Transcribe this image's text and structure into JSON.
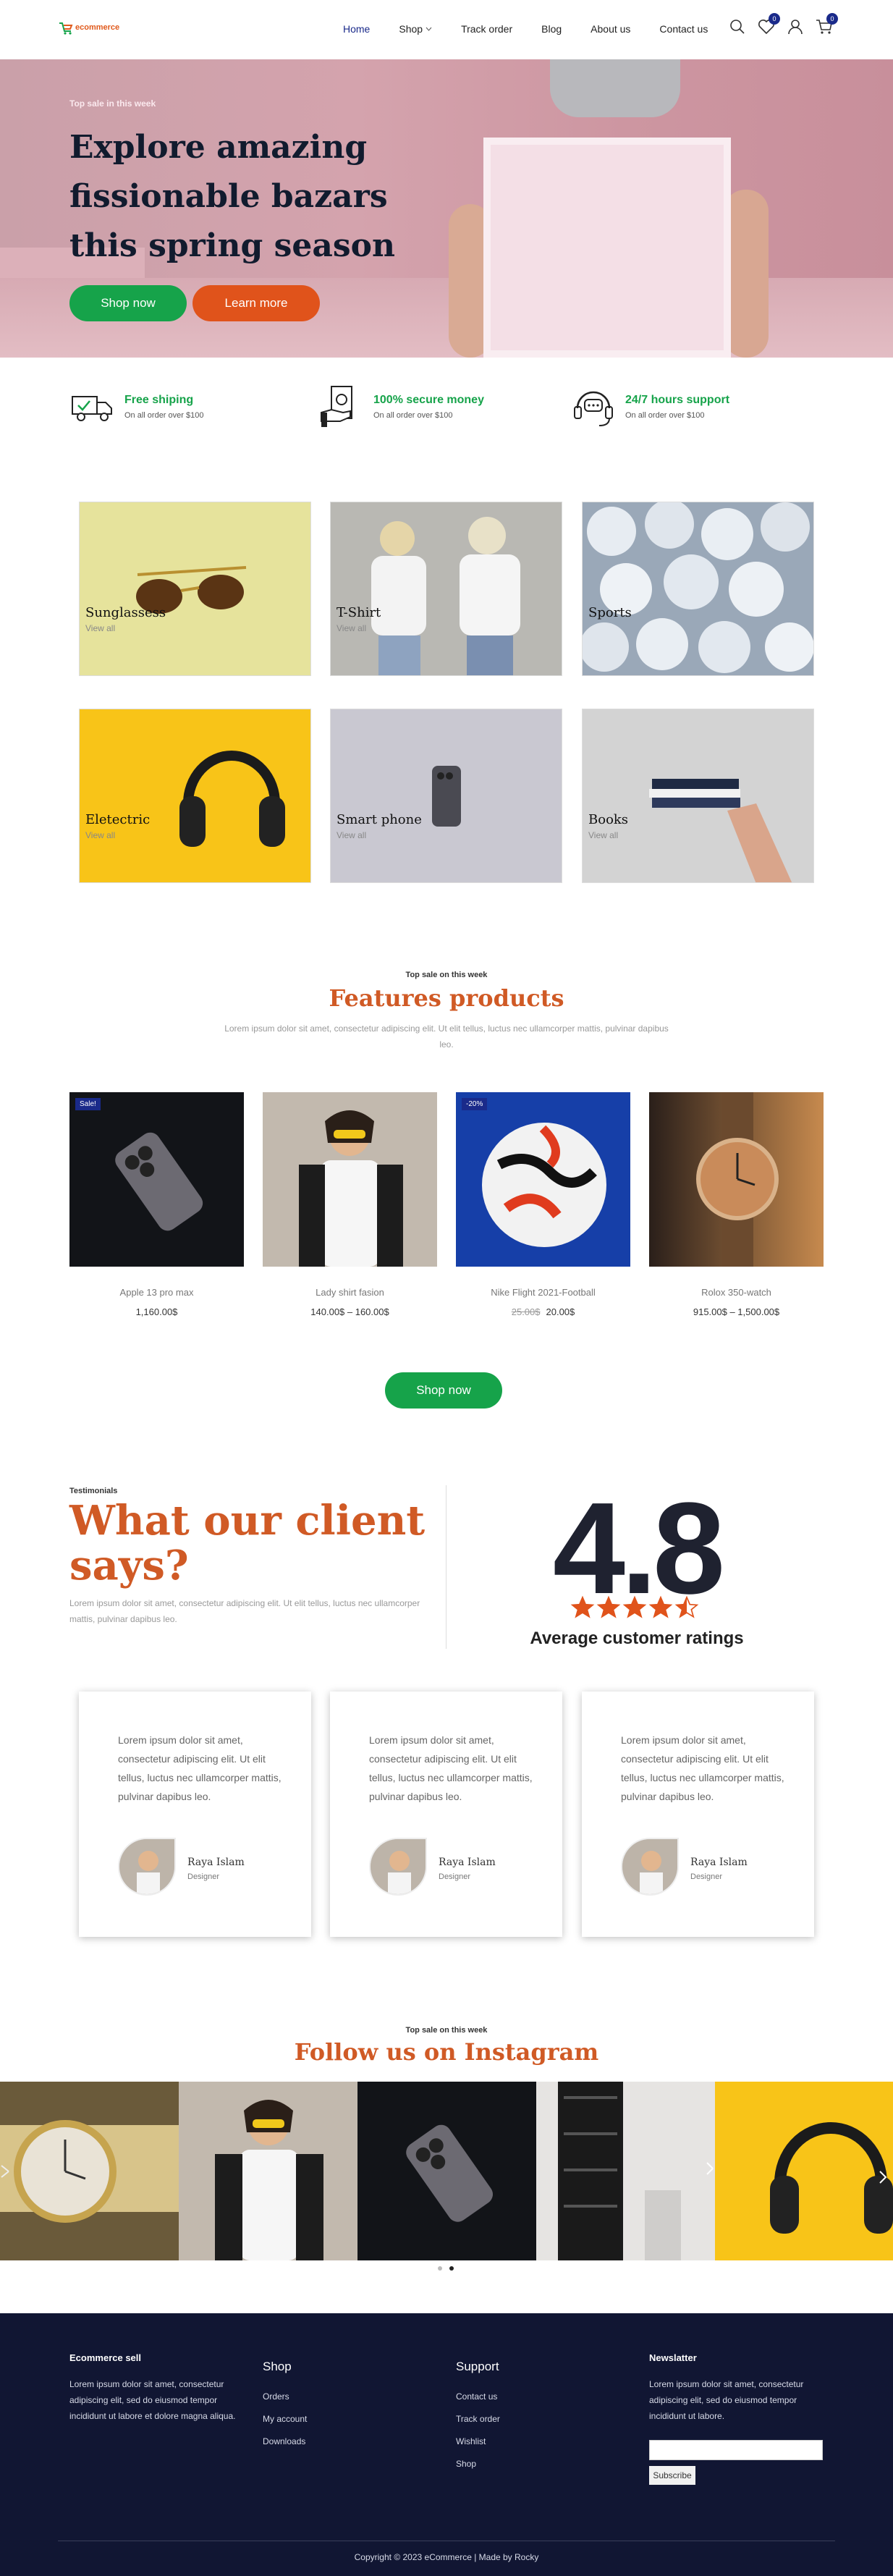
{
  "header": {
    "logo_text": "ecommerce",
    "nav": [
      {
        "label": "Home"
      },
      {
        "label": "Shop"
      },
      {
        "label": "Track order"
      },
      {
        "label": "Blog"
      },
      {
        "label": "About us"
      },
      {
        "label": "Contact us"
      }
    ],
    "wishlist_count": "0",
    "cart_count": "0",
    "accent": "#1a2a8a"
  },
  "hero": {
    "kicker": "Top sale in this week",
    "title": "Explore amazing fissionable bazars this spring season",
    "primary_button": "Shop now",
    "secondary_button": "Learn more"
  },
  "features": [
    {
      "icon": "truck-icon",
      "title": "Free shiping",
      "subtitle": "On all order over $100"
    },
    {
      "icon": "money-icon",
      "title": "100% secure money",
      "subtitle": "On all order over $100"
    },
    {
      "icon": "headset-icon",
      "title": "24/7 hours support",
      "subtitle": "On all order over $100"
    }
  ],
  "categories": [
    {
      "name": "Sunglassess",
      "link": "View all"
    },
    {
      "name": "T-Shirt",
      "link": "View all"
    },
    {
      "name": "Sports",
      "link": ""
    },
    {
      "name": "Eletectric",
      "link": "View all"
    },
    {
      "name": "Smart phone",
      "link": "View all"
    },
    {
      "name": "Books",
      "link": "View all"
    }
  ],
  "featured": {
    "kicker": "Top sale on this week",
    "title": "Features products",
    "description": "Lorem ipsum dolor sit amet, consectetur adipiscing elit. Ut elit tellus, luctus nec ullamcorper mattis, pulvinar dapibus leo.",
    "products": [
      {
        "tag": "Sale!",
        "name": "Apple 13 pro max",
        "old_price": "",
        "price": "1,160.00$"
      },
      {
        "tag": "",
        "name": "Lady shirt fasion",
        "old_price": "",
        "price": "140.00$ – 160.00$"
      },
      {
        "tag": "-20%",
        "name": "Nike Flight 2021-Football",
        "old_price": "25.00$",
        "price": "20.00$"
      },
      {
        "tag": "",
        "name": "Rolox 350-watch",
        "old_price": "",
        "price": "915.00$ – 1,500.00$"
      }
    ],
    "button": "Shop now"
  },
  "testimonials": {
    "kicker": "Testimonials",
    "title": "What our client says?",
    "description": "Lorem ipsum dolor sit amet, consectetur adipiscing elit. Ut elit tellus, luctus nec ullamcorper mattis, pulvinar dapibus leo.",
    "rating": "4.8",
    "rating_stars": 4.5,
    "rating_label": "Average customer ratings",
    "cards": [
      {
        "text": "Lorem ipsum dolor sit amet, consectetur adipiscing elit. Ut elit tellus, luctus nec ullamcorper mattis, pulvinar dapibus leo.",
        "name": "Raya Islam",
        "role": "Designer"
      },
      {
        "text": "Lorem ipsum dolor sit amet, consectetur adipiscing elit. Ut elit tellus, luctus nec ullamcorper mattis, pulvinar dapibus leo.",
        "name": "Raya Islam",
        "role": "Designer"
      },
      {
        "text": "Lorem ipsum dolor sit amet, consectetur adipiscing elit. Ut elit tellus, luctus nec ullamcorper mattis, pulvinar dapibus leo.",
        "name": "Raya Islam",
        "role": "Designer"
      }
    ]
  },
  "instagram": {
    "kicker": "Top sale on this week",
    "title": "Follow us on Instagram"
  },
  "footer": {
    "brand": "Ecommerce sell",
    "brand_text": "Lorem ipsum dolor sit amet, consectetur adipiscing elit, sed do eiusmod tempor incididunt ut labore et dolore magna aliqua.",
    "shop_heading": "Shop",
    "shop_links": [
      "Orders",
      "My account",
      "Downloads"
    ],
    "support_heading": "Support",
    "support_links": [
      "Contact us",
      "Track order",
      "Wishlist",
      "Shop"
    ],
    "newsletter_heading": "Newslatter",
    "newsletter_text": "Lorem ipsum dolor sit amet, consectetur adipiscing elit, sed do eiusmod tempor incididunt ut labore.",
    "subscribe": "Subscribe",
    "copyright": "Copyright © 2023 eCommerce | Made by Rocky"
  }
}
